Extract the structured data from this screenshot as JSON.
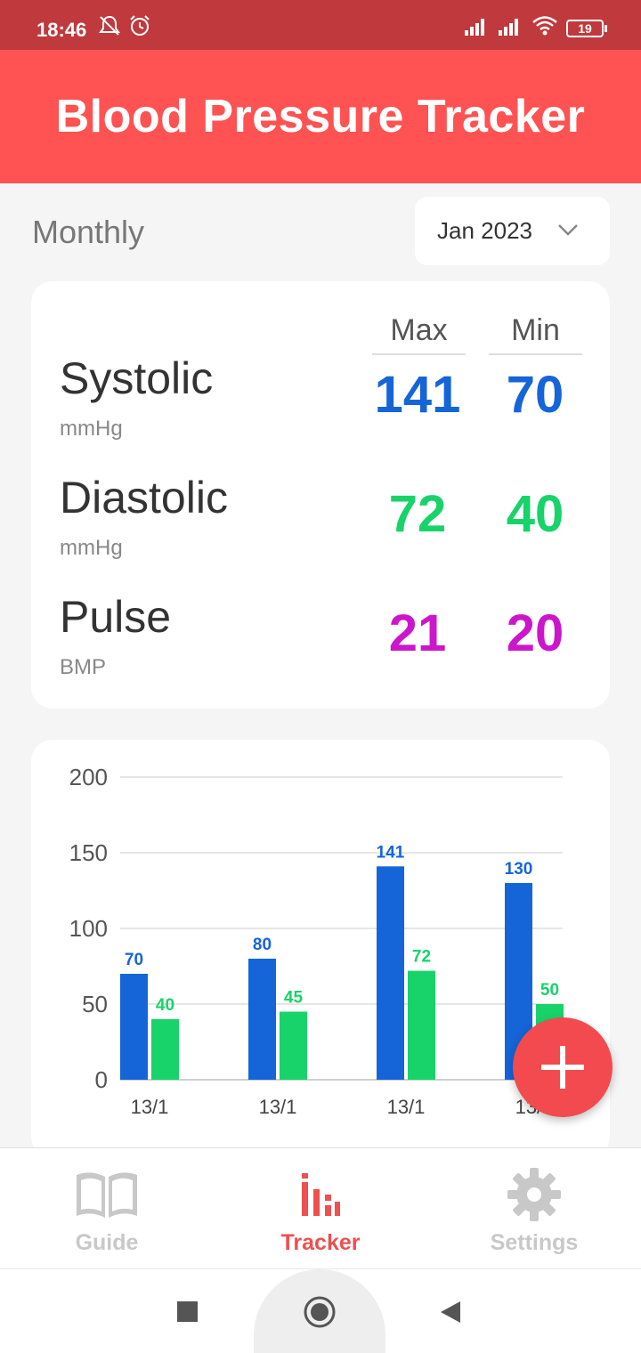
{
  "status_bar": {
    "time": "18:46",
    "battery": "19"
  },
  "app": {
    "title": "Blood Pressure Tracker"
  },
  "filter": {
    "period_label": "Monthly",
    "month_value": "Jan 2023"
  },
  "stats": {
    "col_max": "Max",
    "col_min": "Min",
    "rows": [
      {
        "name": "Systolic",
        "unit": "mmHg",
        "max": "141",
        "min": "70",
        "color": "#1565d8"
      },
      {
        "name": "Diastolic",
        "unit": "mmHg",
        "max": "72",
        "min": "40",
        "color": "#17d36a"
      },
      {
        "name": "Pulse",
        "unit": "BMP",
        "max": "21",
        "min": "20",
        "color": "#cc16cc"
      }
    ]
  },
  "chart_data": {
    "type": "bar",
    "categories": [
      "13/1",
      "13/1",
      "13/1",
      "13/1"
    ],
    "series": [
      {
        "values": [
          70,
          80,
          141,
          130
        ],
        "color": "#1565d8"
      },
      {
        "values": [
          40,
          45,
          72,
          50
        ],
        "color": "#17d36a"
      }
    ],
    "ylim": [
      0,
      200
    ],
    "yticks": [
      0,
      50,
      100,
      150,
      200
    ],
    "grid": true
  },
  "fab": {
    "icon": "plus-icon",
    "color": "#f24a4e"
  },
  "bottom_nav": {
    "items": [
      {
        "label": "Guide",
        "icon": "book-icon",
        "active": false
      },
      {
        "label": "Tracker",
        "icon": "bar-chart-icon",
        "active": true
      },
      {
        "label": "Settings",
        "icon": "gear-icon",
        "active": false
      }
    ]
  },
  "system_nav": {
    "icons": [
      "recents-icon",
      "home-icon",
      "back-icon"
    ]
  }
}
